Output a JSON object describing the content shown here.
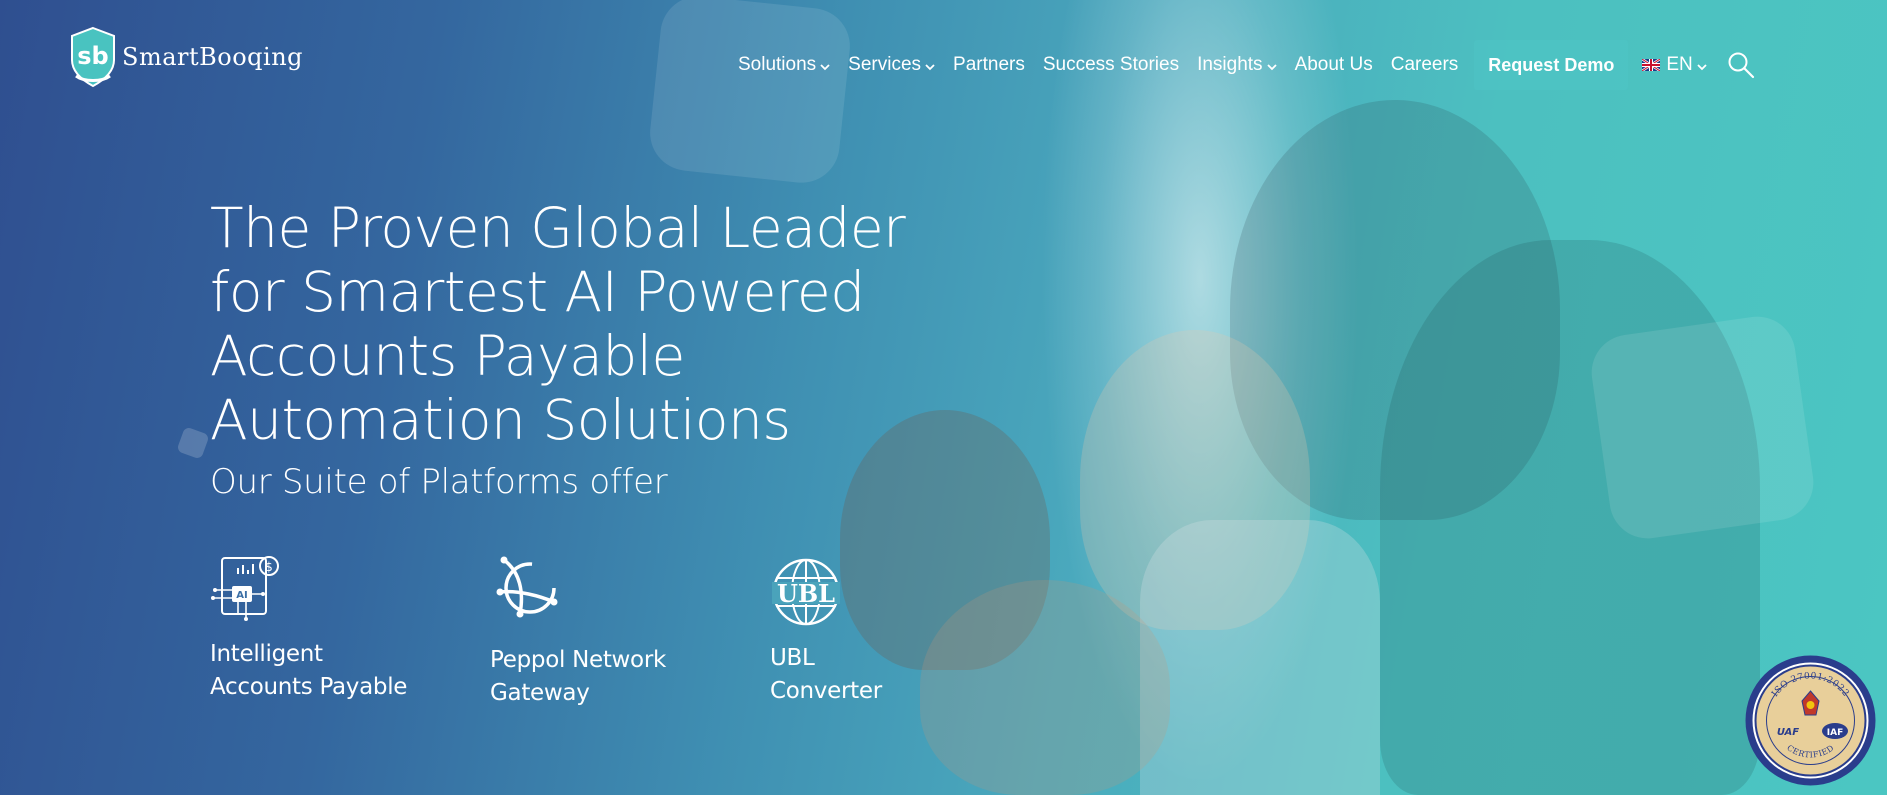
{
  "brand": {
    "name": "SmartBooqing",
    "mark_letters": "sb"
  },
  "nav": {
    "items": [
      {
        "label": "Solutions",
        "dropdown": true
      },
      {
        "label": "Services",
        "dropdown": true
      },
      {
        "label": "Partners",
        "dropdown": false
      },
      {
        "label": "Success Stories",
        "dropdown": false
      },
      {
        "label": "Insights",
        "dropdown": true
      },
      {
        "label": "About Us",
        "dropdown": false
      },
      {
        "label": "Careers",
        "dropdown": false
      }
    ],
    "cta_label": "Request Demo",
    "language": {
      "code": "EN",
      "flag_icon": "uk-flag-icon"
    },
    "search_icon": "search-icon"
  },
  "hero": {
    "headline": "The Proven Global Leader\nfor Smartest AI Powered\nAccounts Payable\nAutomation Solutions",
    "subheadline": "Our Suite of Platforms offer",
    "platforms": [
      {
        "label": "Intelligent\nAccounts Payable",
        "icon": "ai-invoice-icon",
        "icon_text": "AI"
      },
      {
        "label": "Peppol Network\nGateway",
        "icon": "peppol-network-icon"
      },
      {
        "label": "UBL\nConverter",
        "icon": "ubl-globe-icon",
        "icon_text": "UBL"
      }
    ]
  },
  "badge": {
    "icon": "iso-certification-seal",
    "text_top": "ISO 27001:2022",
    "text_bottom": "CERTIFIED",
    "left_mark": "UAF",
    "right_mark": "IAF"
  },
  "colors": {
    "gradient_start": "#2f4f90",
    "gradient_end": "#4bc6c2",
    "logo_shield": "#49c3c0",
    "badge_ring": "#2a3d8c",
    "badge_fill": "#e8cf9a"
  }
}
